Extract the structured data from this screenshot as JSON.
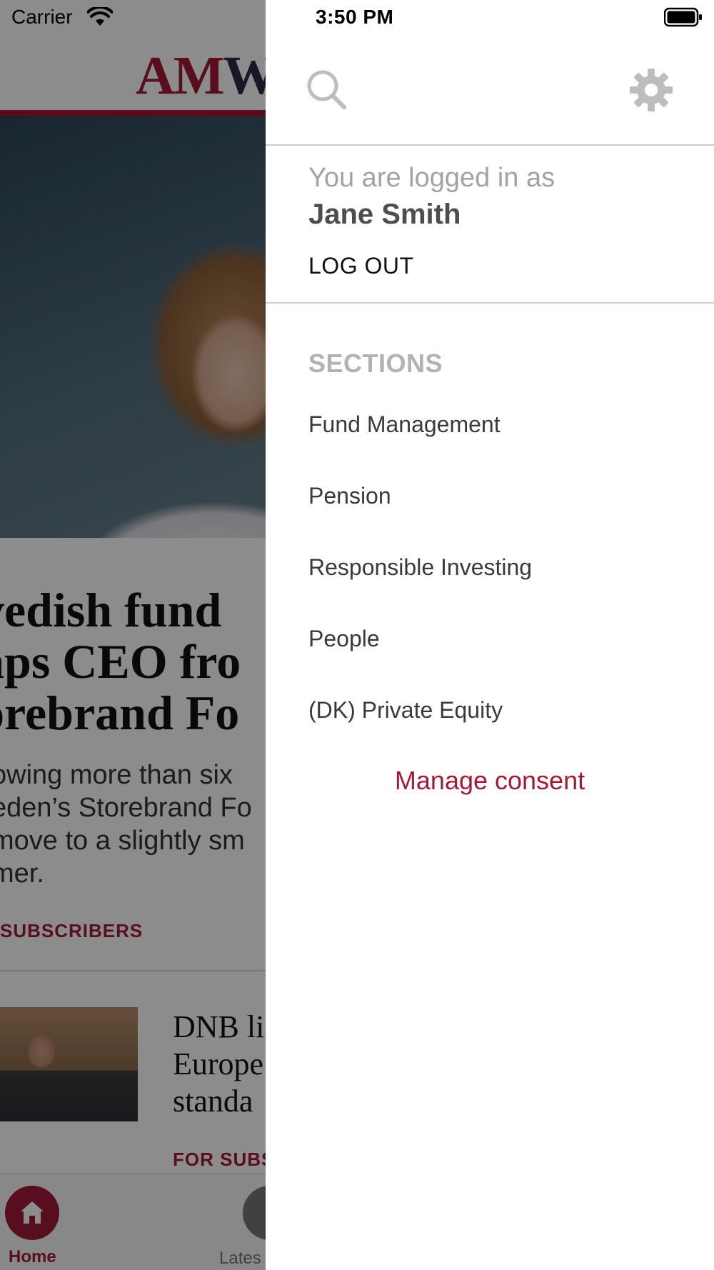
{
  "status_bar": {
    "carrier": "Carrier",
    "time": "3:50 PM"
  },
  "background_app": {
    "logo_am": "AM",
    "logo_w": "W",
    "headline": "vedish fund\naps CEO fro\norebrand Fo",
    "standfirst": "owing more than six\neden’s Storebrand Fo\nmove to a slightly sm\nmer.",
    "tag_subscribers": "SUBSCRIBERS",
    "story2_title": "DNB li\nEurope\nstanda",
    "story2_tag": "FOR SUBS",
    "tabbar": {
      "home_label": "Home",
      "latest_label": "Lates"
    }
  },
  "drawer": {
    "logged_in_label": "You are logged in as",
    "user_name": "Jane Smith",
    "logout_label": "LOG OUT",
    "sections_title": "SECTIONS",
    "sections": [
      {
        "label": "Fund Management"
      },
      {
        "label": "Pension"
      },
      {
        "label": "Responsible Investing"
      },
      {
        "label": "People"
      },
      {
        "label": "(DK) Private Equity"
      }
    ],
    "manage_consent_label": "Manage consent"
  },
  "icons": {
    "search": "search-icon",
    "settings": "gear-icon",
    "wifi": "wifi-icon",
    "battery": "battery-icon",
    "home": "home-icon"
  },
  "colors": {
    "brand_red": "#a21b35",
    "muted_gray": "#a3a3a3",
    "icon_gray": "#bdbdbd"
  }
}
